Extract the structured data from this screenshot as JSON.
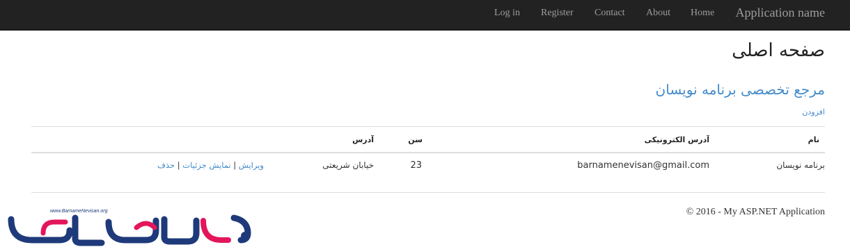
{
  "navbar": {
    "brand": "Application name",
    "items": [
      "Home",
      "About",
      "Contact",
      "Register",
      "Log in"
    ]
  },
  "page": {
    "title": "صفحه اصلی",
    "subtitle": "مرجع تخصصی برنامه نویسان",
    "add_link": "افزودن"
  },
  "table": {
    "headers": {
      "name": "نام",
      "email": "آدرس الکترونیکی",
      "age": "سن",
      "address": "آدرس"
    },
    "rows": [
      {
        "name": "برنامه نویسان",
        "email": "barnamenevisan@gmail.com",
        "age": "23",
        "address": "خیابان شریعتی",
        "actions": [
          "ویرایش",
          "نمایش جزئیات",
          "حذف"
        ],
        "separator": "|"
      }
    ]
  },
  "footer": {
    "text": "© 2016 - My ASP.NET Application"
  },
  "logo": {
    "url_text": "www.BarnameNevisan.org",
    "wordmark": "برنامه نویسان",
    "colors": {
      "primary": "#1e3a7a",
      "accent": "#e3165b"
    }
  },
  "colors": {
    "navbar_bg": "#222222",
    "nav_text": "#9d9d9d",
    "link": "#428bca",
    "rule": "#dddddd"
  }
}
